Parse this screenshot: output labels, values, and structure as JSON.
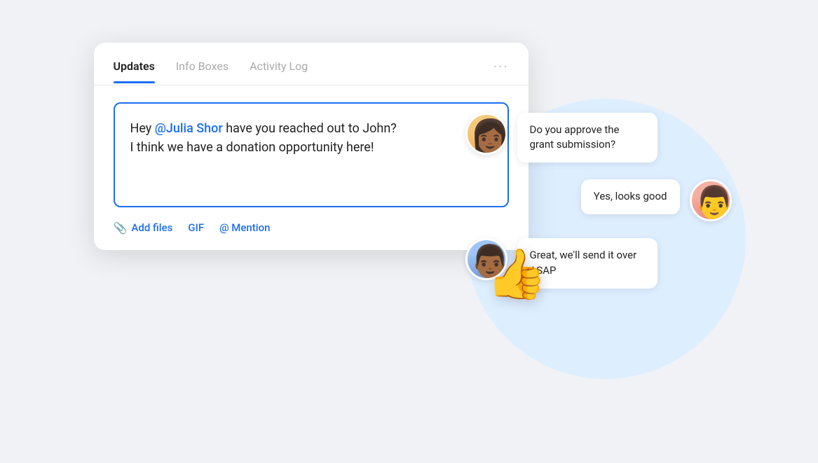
{
  "tabs": [
    {
      "id": "updates",
      "label": "Updates",
      "active": true
    },
    {
      "id": "info-boxes",
      "label": "Info Boxes",
      "active": false
    },
    {
      "id": "activity-log",
      "label": "Activity Log",
      "active": false
    }
  ],
  "tabs_more": "···",
  "message": {
    "prefix": "Hey ",
    "mention": "@Julia Shor",
    "suffix_line1": " have you reached out to John?",
    "line2": "I think we have a donation opportunity here!"
  },
  "toolbar": {
    "add_files": "Add files",
    "gif": "GIF",
    "mention": "@ Mention"
  },
  "chat": {
    "messages": [
      {
        "id": 1,
        "avatar": "1",
        "side": "left",
        "text": "Do you approve the grant submission?"
      },
      {
        "id": 2,
        "avatar": "2",
        "side": "right",
        "text": "Yes, looks good"
      },
      {
        "id": 3,
        "avatar": "3",
        "side": "left",
        "text": "Great, we'll send it over ASAP"
      }
    ]
  },
  "thumbs_up": "👍",
  "colors": {
    "accent": "#1b6ef3",
    "circle_bg": "#ddeeff"
  }
}
